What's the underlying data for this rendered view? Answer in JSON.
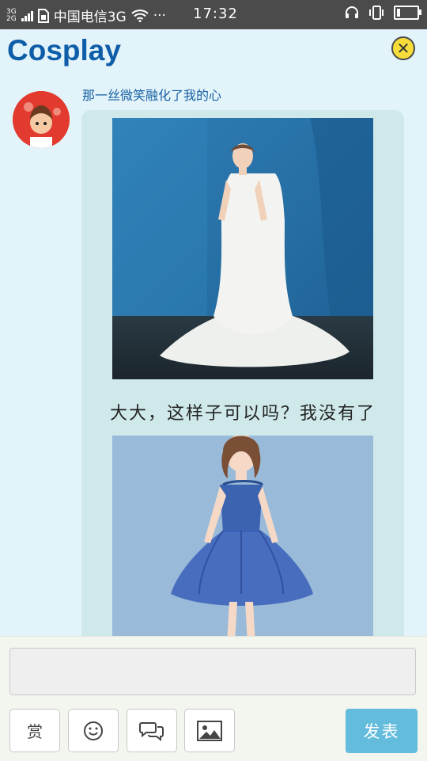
{
  "status_bar": {
    "network_top": "3G",
    "network_bottom": "2G",
    "carrier": "中国电信3G",
    "dots": "···",
    "time": "17:32"
  },
  "header": {
    "title": "Cosplay",
    "close_icon": "close-icon"
  },
  "post": {
    "author": "那一丝微笑融化了我的心",
    "caption": "大大，这样子可以吗？我没有了",
    "images": [
      {
        "name": "white-wedding-gown-photo",
        "icon": "photo"
      },
      {
        "name": "blue-party-dress-photo",
        "icon": "photo"
      }
    ]
  },
  "composer": {
    "reward_label": "赏",
    "emoji_icon": "smiley-icon",
    "comment_icon": "speech-bubbles-icon",
    "image_icon": "picture-icon",
    "submit_label": "发表"
  },
  "colors": {
    "title": "#0e5da8",
    "status_bar_bg": "#4b4b4b",
    "page_bg": "#e2f3f9",
    "card_bg": "#cfe9ea",
    "submit_bg": "#63bcdc"
  }
}
